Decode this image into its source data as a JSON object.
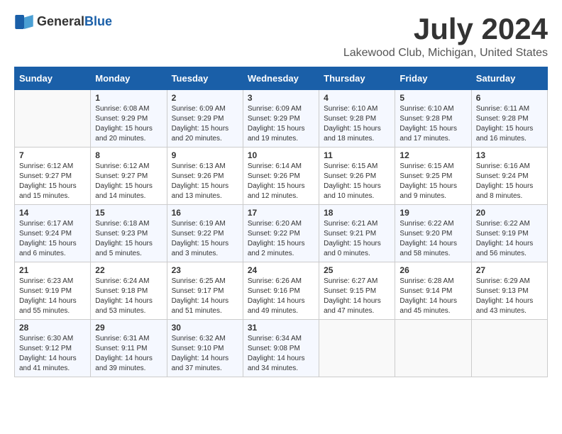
{
  "header": {
    "logo_general": "General",
    "logo_blue": "Blue",
    "title": "July 2024",
    "location": "Lakewood Club, Michigan, United States"
  },
  "calendar": {
    "days_of_week": [
      "Sunday",
      "Monday",
      "Tuesday",
      "Wednesday",
      "Thursday",
      "Friday",
      "Saturday"
    ],
    "weeks": [
      [
        {
          "day": "",
          "content": ""
        },
        {
          "day": "1",
          "content": "Sunrise: 6:08 AM\nSunset: 9:29 PM\nDaylight: 15 hours\nand 20 minutes."
        },
        {
          "day": "2",
          "content": "Sunrise: 6:09 AM\nSunset: 9:29 PM\nDaylight: 15 hours\nand 20 minutes."
        },
        {
          "day": "3",
          "content": "Sunrise: 6:09 AM\nSunset: 9:29 PM\nDaylight: 15 hours\nand 19 minutes."
        },
        {
          "day": "4",
          "content": "Sunrise: 6:10 AM\nSunset: 9:28 PM\nDaylight: 15 hours\nand 18 minutes."
        },
        {
          "day": "5",
          "content": "Sunrise: 6:10 AM\nSunset: 9:28 PM\nDaylight: 15 hours\nand 17 minutes."
        },
        {
          "day": "6",
          "content": "Sunrise: 6:11 AM\nSunset: 9:28 PM\nDaylight: 15 hours\nand 16 minutes."
        }
      ],
      [
        {
          "day": "7",
          "content": "Sunrise: 6:12 AM\nSunset: 9:27 PM\nDaylight: 15 hours\nand 15 minutes."
        },
        {
          "day": "8",
          "content": "Sunrise: 6:12 AM\nSunset: 9:27 PM\nDaylight: 15 hours\nand 14 minutes."
        },
        {
          "day": "9",
          "content": "Sunrise: 6:13 AM\nSunset: 9:26 PM\nDaylight: 15 hours\nand 13 minutes."
        },
        {
          "day": "10",
          "content": "Sunrise: 6:14 AM\nSunset: 9:26 PM\nDaylight: 15 hours\nand 12 minutes."
        },
        {
          "day": "11",
          "content": "Sunrise: 6:15 AM\nSunset: 9:26 PM\nDaylight: 15 hours\nand 10 minutes."
        },
        {
          "day": "12",
          "content": "Sunrise: 6:15 AM\nSunset: 9:25 PM\nDaylight: 15 hours\nand 9 minutes."
        },
        {
          "day": "13",
          "content": "Sunrise: 6:16 AM\nSunset: 9:24 PM\nDaylight: 15 hours\nand 8 minutes."
        }
      ],
      [
        {
          "day": "14",
          "content": "Sunrise: 6:17 AM\nSunset: 9:24 PM\nDaylight: 15 hours\nand 6 minutes."
        },
        {
          "day": "15",
          "content": "Sunrise: 6:18 AM\nSunset: 9:23 PM\nDaylight: 15 hours\nand 5 minutes."
        },
        {
          "day": "16",
          "content": "Sunrise: 6:19 AM\nSunset: 9:22 PM\nDaylight: 15 hours\nand 3 minutes."
        },
        {
          "day": "17",
          "content": "Sunrise: 6:20 AM\nSunset: 9:22 PM\nDaylight: 15 hours\nand 2 minutes."
        },
        {
          "day": "18",
          "content": "Sunrise: 6:21 AM\nSunset: 9:21 PM\nDaylight: 15 hours\nand 0 minutes."
        },
        {
          "day": "19",
          "content": "Sunrise: 6:22 AM\nSunset: 9:20 PM\nDaylight: 14 hours\nand 58 minutes."
        },
        {
          "day": "20",
          "content": "Sunrise: 6:22 AM\nSunset: 9:19 PM\nDaylight: 14 hours\nand 56 minutes."
        }
      ],
      [
        {
          "day": "21",
          "content": "Sunrise: 6:23 AM\nSunset: 9:19 PM\nDaylight: 14 hours\nand 55 minutes."
        },
        {
          "day": "22",
          "content": "Sunrise: 6:24 AM\nSunset: 9:18 PM\nDaylight: 14 hours\nand 53 minutes."
        },
        {
          "day": "23",
          "content": "Sunrise: 6:25 AM\nSunset: 9:17 PM\nDaylight: 14 hours\nand 51 minutes."
        },
        {
          "day": "24",
          "content": "Sunrise: 6:26 AM\nSunset: 9:16 PM\nDaylight: 14 hours\nand 49 minutes."
        },
        {
          "day": "25",
          "content": "Sunrise: 6:27 AM\nSunset: 9:15 PM\nDaylight: 14 hours\nand 47 minutes."
        },
        {
          "day": "26",
          "content": "Sunrise: 6:28 AM\nSunset: 9:14 PM\nDaylight: 14 hours\nand 45 minutes."
        },
        {
          "day": "27",
          "content": "Sunrise: 6:29 AM\nSunset: 9:13 PM\nDaylight: 14 hours\nand 43 minutes."
        }
      ],
      [
        {
          "day": "28",
          "content": "Sunrise: 6:30 AM\nSunset: 9:12 PM\nDaylight: 14 hours\nand 41 minutes."
        },
        {
          "day": "29",
          "content": "Sunrise: 6:31 AM\nSunset: 9:11 PM\nDaylight: 14 hours\nand 39 minutes."
        },
        {
          "day": "30",
          "content": "Sunrise: 6:32 AM\nSunset: 9:10 PM\nDaylight: 14 hours\nand 37 minutes."
        },
        {
          "day": "31",
          "content": "Sunrise: 6:34 AM\nSunset: 9:08 PM\nDaylight: 14 hours\nand 34 minutes."
        },
        {
          "day": "",
          "content": ""
        },
        {
          "day": "",
          "content": ""
        },
        {
          "day": "",
          "content": ""
        }
      ]
    ]
  }
}
